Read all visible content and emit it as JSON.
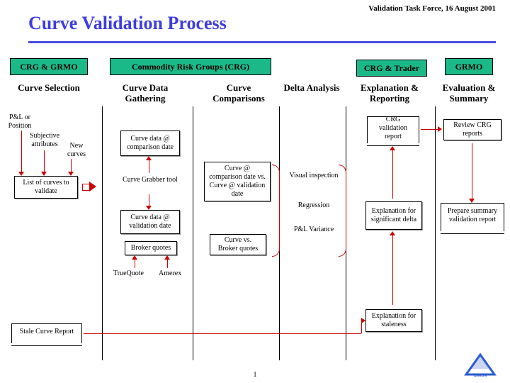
{
  "header": {
    "date": "Validation Task Force, 16 August 2001",
    "title": "Curve Validation Process",
    "page": "1"
  },
  "owners": {
    "crg_grmo": "CRG & GRMO",
    "crg": "Commodity Risk Groups (CRG)",
    "crg_trader": "CRG & Trader",
    "grmo": "GRMO"
  },
  "cols": {
    "c1": "Curve Selection",
    "c2": "Curve Data Gathering",
    "c3": "Curve Comparisons",
    "c4": "Delta Analysis",
    "c5": "Explanation & Reporting",
    "c6": "Evaluation & Summary"
  },
  "col1": {
    "pl": "P&L or Position",
    "subj": "Subjective attributes",
    "new": "New curves",
    "list": "List of curves to validate",
    "stale": "Stale Curve Report"
  },
  "col2": {
    "comp": "Curve data @ comparison date",
    "grabber": "Curve Grabber tool",
    "val": "Curve data @ validation date",
    "broker": "Broker quotes",
    "tq": "TrueQuote",
    "am": "Amerex"
  },
  "col3": {
    "cmp": "Curve @ comparison date vs. Curve @ validation date",
    "bq": "Curve vs. Broker quotes"
  },
  "col4": {
    "vis": "Visual inspection",
    "reg": "Regression",
    "plv": "P&L Variance"
  },
  "col5": {
    "rpt": "CRG validation report",
    "expl": "Explanation for significant delta",
    "stale": "Explanation for staleness"
  },
  "col6": {
    "rev": "Review CRG reports",
    "sum": "Prepare summary validation report"
  },
  "logo": {
    "name": "ENRON"
  }
}
